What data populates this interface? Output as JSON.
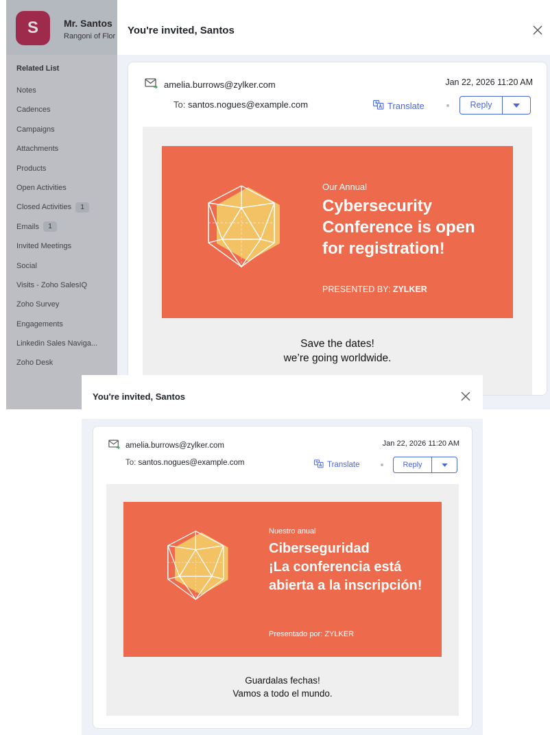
{
  "crm": {
    "avatar_letter": "S",
    "contact_name": "Mr. Santos",
    "contact_subtitle": "Rangoni of Flor",
    "related_title": "Related List",
    "items": [
      {
        "label": "Notes",
        "badge": ""
      },
      {
        "label": "Cadences",
        "badge": ""
      },
      {
        "label": "Campaigns",
        "badge": ""
      },
      {
        "label": "Attachments",
        "badge": ""
      },
      {
        "label": "Products",
        "badge": ""
      },
      {
        "label": "Open Activities",
        "badge": ""
      },
      {
        "label": "Closed Activities",
        "badge": "1"
      },
      {
        "label": "Emails",
        "badge": "1"
      },
      {
        "label": "Invited Meetings",
        "badge": ""
      },
      {
        "label": "Social",
        "badge": ""
      },
      {
        "label": "Visits - Zoho SalesIQ",
        "badge": ""
      },
      {
        "label": "Zoho Survey",
        "badge": ""
      },
      {
        "label": "Engagements",
        "badge": ""
      },
      {
        "label": "Linkedin Sales Naviga...",
        "badge": ""
      },
      {
        "label": "Zoho Desk",
        "badge": ""
      }
    ]
  },
  "original": {
    "title": "You're invited, Santos",
    "from": "amelia.burrows@zylker.com",
    "date": "Jan 22, 2026 11:20 AM",
    "to_label": "To:",
    "to": "santos.nogues@example.com",
    "translate": "Translate",
    "reply": "Reply",
    "banner_pre": "Our Annual",
    "banner_head": "Cybersecurity Conference is open for registration!",
    "banner_presented_prefix": "PRESENTED BY:",
    "banner_presented_name": "ZYLKER",
    "tagline_1": "Save the dates!",
    "tagline_2": "we’re going worldwide."
  },
  "translated": {
    "title": "You're invited, Santos",
    "from": "amelia.burrows@zylker.com",
    "date": "Jan 22, 2026 11:20 AM",
    "to_label": "To:",
    "to": "santos.nogues@example.com",
    "translate": "Translate",
    "reply": "Reply",
    "banner_pre": "Nuestro anual",
    "banner_head_1": "Ciberseguridad",
    "banner_head_2": "¡La conferencia está abierta a la inscripción!",
    "banner_presented": "Presentado por: ZYLKER",
    "tagline_1": "Guardalas fechas!",
    "tagline_2": "Vamos a todo el mundo."
  },
  "colors": {
    "accent": "#4a66d8",
    "banner": "#ee6a4c",
    "gem": "#f2c265",
    "avatar": "#b5284e"
  },
  "icons": [
    "mail-icon",
    "translate-icon",
    "close-icon",
    "caret-down-icon",
    "icosahedron-graphic"
  ]
}
